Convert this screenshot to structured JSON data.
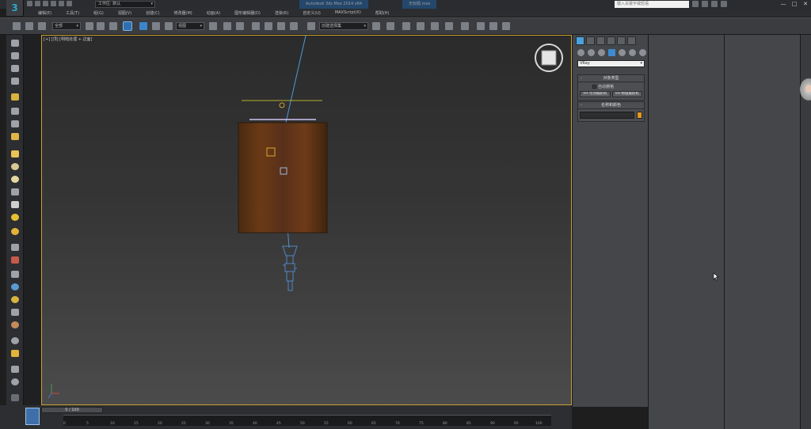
{
  "title_bar": {
    "workspace_label": "工作区: 默认",
    "document_title": "Autodesk 3ds Max 2014 x64",
    "file_title": "无标题.max",
    "search_placeholder": "键入关键字或短语",
    "window_controls": [
      "—",
      "□",
      "✕"
    ]
  },
  "menu": [
    "编辑(E)",
    "工具(T)",
    "组(G)",
    "视图(V)",
    "创建(C)",
    "修改器(M)",
    "动画(A)",
    "图形编辑器(D)",
    "渲染(R)",
    "自定义(U)",
    "MAXScript(X)",
    "帮助(H)"
  ],
  "toolbar": {
    "selection_filter": "全部",
    "reference_coord": "视图",
    "named_selection": "创建选择集"
  },
  "viewport": {
    "label": "[+] [顶] [明暗处理 + 边面]",
    "accent_border": "#c8a030"
  },
  "command_panel": {
    "renderer_dropdown": "VRay",
    "object_type": {
      "title": "对象类型",
      "autogrid_label": "自动栅格",
      "buttons": [
        "VR-穹顶摄影机",
        "VR-物理摄影机"
      ]
    },
    "name_color": {
      "title": "名称和颜色",
      "swatch_color": "#e39a1f"
    }
  },
  "timeline": {
    "slider_text": "0 / 100",
    "ticks": [
      "0",
      "5",
      "10",
      "15",
      "20",
      "25",
      "30",
      "35",
      "40",
      "45",
      "50",
      "55",
      "60",
      "65",
      "70",
      "75",
      "80",
      "85",
      "90",
      "95",
      "100"
    ]
  }
}
